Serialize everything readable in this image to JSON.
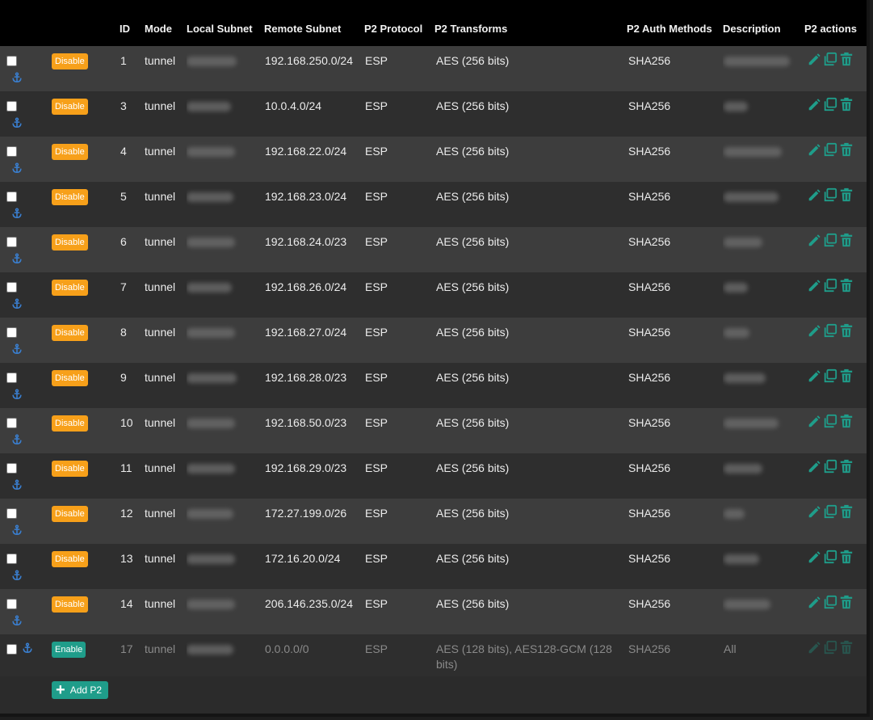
{
  "headers": {
    "id": "ID",
    "mode": "Mode",
    "local_subnet": "Local Subnet",
    "remote_subnet": "Remote Subnet",
    "p2_protocol": "P2 Protocol",
    "p2_transforms": "P2 Transforms",
    "p2_auth": "P2 Auth Methods",
    "description": "Description",
    "p2_actions": "P2 actions"
  },
  "rows": [
    {
      "toggle": "Disable",
      "id": "1",
      "mode": "tunnel",
      "remote": "192.168.250.0/24",
      "protocol": "ESP",
      "transforms": "AES (256 bits)",
      "auth": "SHA256",
      "description": ""
    },
    {
      "toggle": "Disable",
      "id": "3",
      "mode": "tunnel",
      "remote": "10.0.4.0/24",
      "protocol": "ESP",
      "transforms": "AES (256 bits)",
      "auth": "SHA256",
      "description": ""
    },
    {
      "toggle": "Disable",
      "id": "4",
      "mode": "tunnel",
      "remote": "192.168.22.0/24",
      "protocol": "ESP",
      "transforms": "AES (256 bits)",
      "auth": "SHA256",
      "description": ""
    },
    {
      "toggle": "Disable",
      "id": "5",
      "mode": "tunnel",
      "remote": "192.168.23.0/24",
      "protocol": "ESP",
      "transforms": "AES (256 bits)",
      "auth": "SHA256",
      "description": ""
    },
    {
      "toggle": "Disable",
      "id": "6",
      "mode": "tunnel",
      "remote": "192.168.24.0/23",
      "protocol": "ESP",
      "transforms": "AES (256 bits)",
      "auth": "SHA256",
      "description": ""
    },
    {
      "toggle": "Disable",
      "id": "7",
      "mode": "tunnel",
      "remote": "192.168.26.0/24",
      "protocol": "ESP",
      "transforms": "AES (256 bits)",
      "auth": "SHA256",
      "description": ""
    },
    {
      "toggle": "Disable",
      "id": "8",
      "mode": "tunnel",
      "remote": "192.168.27.0/24",
      "protocol": "ESP",
      "transforms": "AES (256 bits)",
      "auth": "SHA256",
      "description": ""
    },
    {
      "toggle": "Disable",
      "id": "9",
      "mode": "tunnel",
      "remote": "192.168.28.0/23",
      "protocol": "ESP",
      "transforms": "AES (256 bits)",
      "auth": "SHA256",
      "description": ""
    },
    {
      "toggle": "Disable",
      "id": "10",
      "mode": "tunnel",
      "remote": "192.168.50.0/23",
      "protocol": "ESP",
      "transforms": "AES (256 bits)",
      "auth": "SHA256",
      "description": ""
    },
    {
      "toggle": "Disable",
      "id": "11",
      "mode": "tunnel",
      "remote": "192.168.29.0/23",
      "protocol": "ESP",
      "transforms": "AES (256 bits)",
      "auth": "SHA256",
      "description": ""
    },
    {
      "toggle": "Disable",
      "id": "12",
      "mode": "tunnel",
      "remote": "172.27.199.0/26",
      "protocol": "ESP",
      "transforms": "AES (256 bits)",
      "auth": "SHA256",
      "description": ""
    },
    {
      "toggle": "Disable",
      "id": "13",
      "mode": "tunnel",
      "remote": "172.16.20.0/24",
      "protocol": "ESP",
      "transforms": "AES (256 bits)",
      "auth": "SHA256",
      "description": ""
    },
    {
      "toggle": "Disable",
      "id": "14",
      "mode": "tunnel",
      "remote": "206.146.235.0/24",
      "protocol": "ESP",
      "transforms": "AES (256 bits)",
      "auth": "SHA256",
      "description": ""
    },
    {
      "toggle": "Enable",
      "id": "17",
      "mode": "tunnel",
      "remote": "0.0.0.0/0",
      "protocol": "ESP",
      "transforms": "AES (128 bits), AES128-GCM (128 bits)",
      "auth": "SHA256",
      "description": "All"
    }
  ],
  "add_button": "Add P2",
  "icons": {
    "anchor": "anchor-icon",
    "edit": "pencil-icon",
    "copy": "copy-icon",
    "delete": "trash-icon",
    "add": "plus-icon"
  },
  "colors": {
    "disable_button": "#f7a01a",
    "enable_button": "#1f9d8a",
    "action_icon": "#1f9d8a",
    "anchor_icon": "#3a7fd0"
  }
}
